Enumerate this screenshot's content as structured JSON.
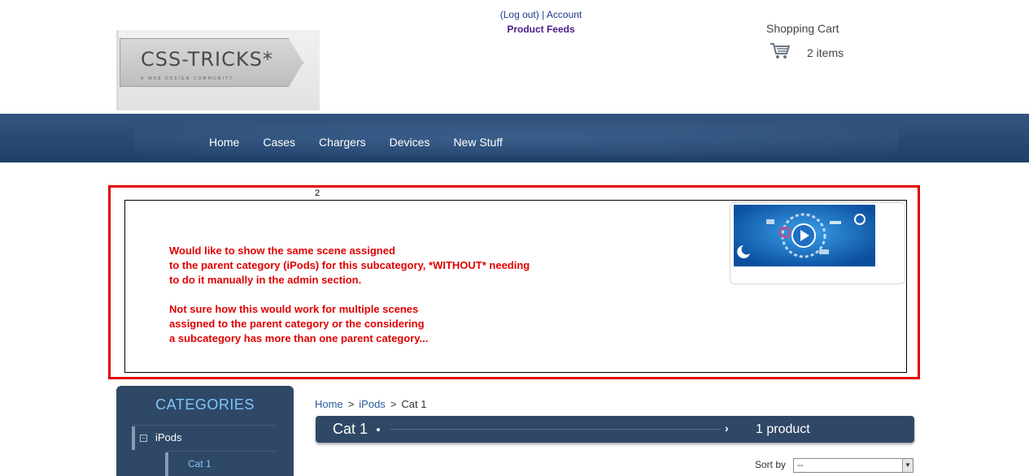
{
  "header": {
    "logo": {
      "brand": "CSS-TRICKS*",
      "tagline": "A WEB DESIGN COMMUNITY"
    },
    "links": {
      "logout": "(Log out)",
      "separator": "|",
      "account": "Account",
      "product_feeds": "Product Feeds"
    },
    "cart": {
      "title": "Shopping Cart",
      "items": "2 items",
      "icon": "cart-icon"
    }
  },
  "nav": {
    "items": [
      "Home",
      "Cases",
      "Chargers",
      "Devices",
      "New Stuff"
    ]
  },
  "annotation": {
    "number": "2",
    "lines": [
      "Would like to show the same scene assigned",
      "to the parent category (iPods) for this subcategory, *WITHOUT* needing",
      "to do it manually in the admin section.",
      "",
      "Not sure how this would work for multiple scenes",
      "assigned to the parent category or the considering",
      "a subcategory has more than one parent category..."
    ],
    "colors": {
      "box": "#e30000",
      "text": "#e00000"
    }
  },
  "sidebar": {
    "heading": "CATEGORIES",
    "category": {
      "label": "iPods",
      "expander": "⊟"
    },
    "subcategory": {
      "label": "Cat 1"
    }
  },
  "main": {
    "breadcrumb": {
      "home": "Home",
      "sep1": ">",
      "parent": "iPods",
      "sep2": ">",
      "current": "Cat 1"
    },
    "category_bar": {
      "name": "Cat 1",
      "chevron": "›",
      "count": "1 product"
    },
    "sort": {
      "label": "Sort by",
      "selected": "--"
    }
  },
  "colors": {
    "nav_bg": "#2a4a72",
    "sidebar_bg": "#2f4866",
    "accent_light": "#7cc6ff"
  }
}
